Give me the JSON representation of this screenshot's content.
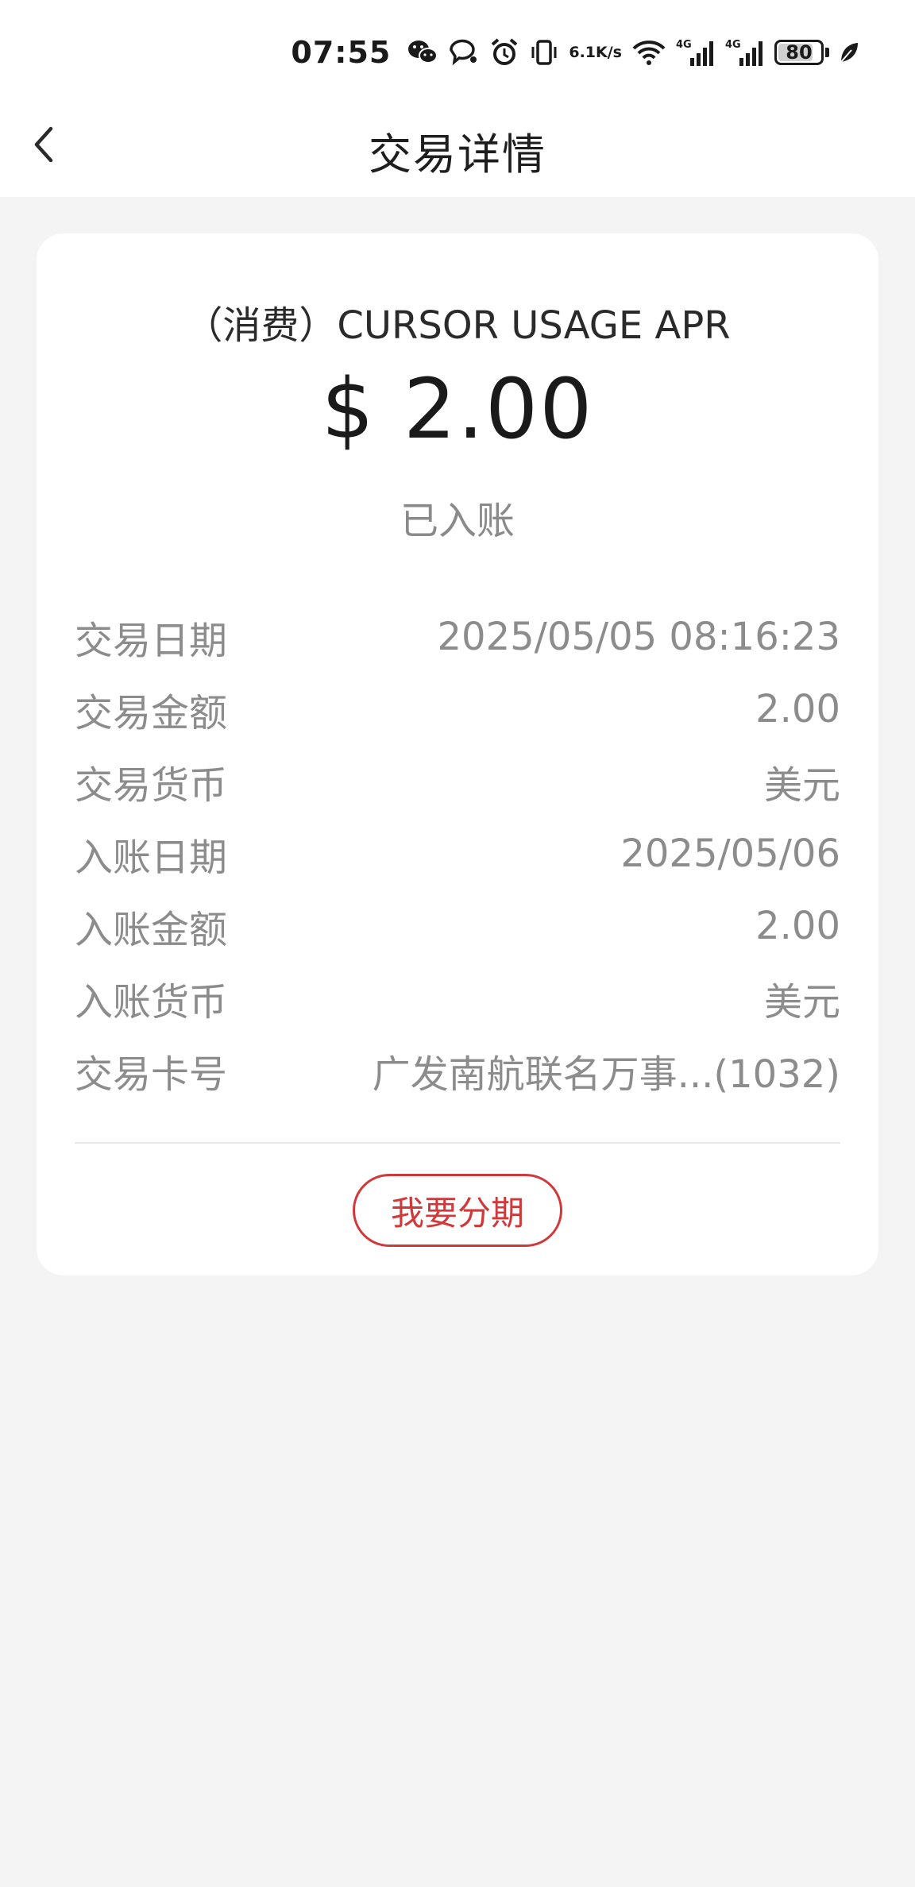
{
  "status_bar": {
    "time": "07:55",
    "network_speed_top": "6.1",
    "network_speed_bottom": "K/s",
    "signal1_label": "4G",
    "signal2_label": "4G",
    "battery_level": "80",
    "icons": [
      "wechat-icon",
      "chat-bubble-icon",
      "alarm-icon",
      "vibrate-icon",
      "wifi-icon",
      "signal-icon",
      "signal-icon",
      "battery-icon",
      "leaf-icon"
    ]
  },
  "nav": {
    "title": "交易详情",
    "back_icon": "chevron-left-icon"
  },
  "transaction": {
    "merchant": "（消费）CURSOR USAGE APR",
    "amount": "$ 2.00",
    "status": "已入账",
    "details": [
      {
        "label": "交易日期",
        "value": "2025/05/05 08:16:23"
      },
      {
        "label": "交易金额",
        "value": "2.00"
      },
      {
        "label": "交易货币",
        "value": "美元"
      },
      {
        "label": "入账日期",
        "value": "2025/05/06"
      },
      {
        "label": "入账金额",
        "value": "2.00"
      },
      {
        "label": "入账货币",
        "value": "美元"
      },
      {
        "label": "交易卡号",
        "value": "广发南航联名万事...(1032)"
      }
    ],
    "installment_button": "我要分期"
  },
  "colors": {
    "accent": "#d0383a",
    "background": "#f4f4f4",
    "card": "#ffffff",
    "muted_text": "#8c8c8c"
  }
}
